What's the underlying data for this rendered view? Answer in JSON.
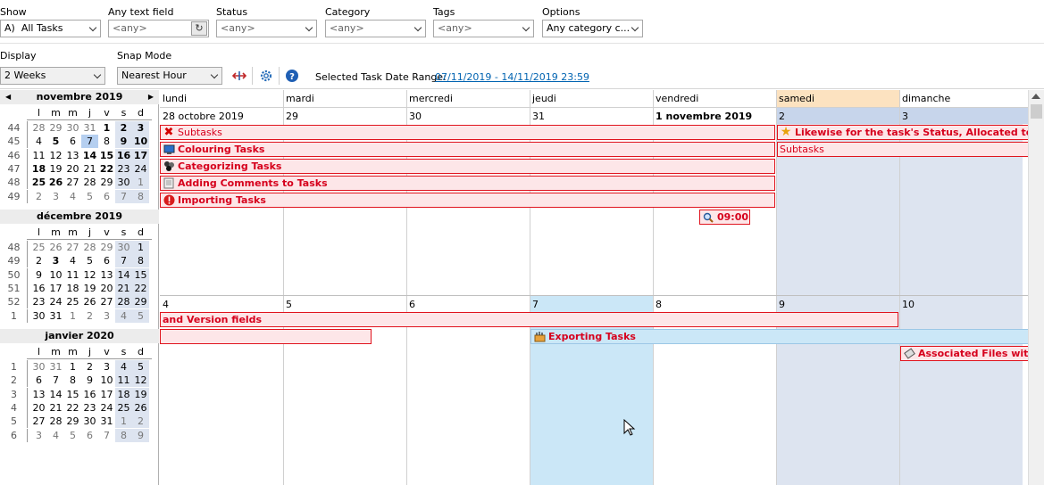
{
  "filters": {
    "show": {
      "label": "Show",
      "prefix": "A)",
      "value": "All Tasks"
    },
    "text": {
      "label": "Any text field",
      "placeholder": "<any>"
    },
    "status": {
      "label": "Status",
      "value": "<any>"
    },
    "category": {
      "label": "Category",
      "value": "<any>"
    },
    "tags": {
      "label": "Tags",
      "value": "<any>"
    },
    "options": {
      "label": "Options",
      "value": "Any category c..."
    }
  },
  "display": {
    "label": "Display",
    "value": "2 Weeks"
  },
  "snap": {
    "label": "Snap Mode",
    "value": "Nearest Hour"
  },
  "range": {
    "label": "Selected Task Date Range:",
    "value": "07/11/2019 - 14/11/2019 23:59"
  },
  "colors": {
    "task_border": "#e0141e",
    "task_fill": "#fde6e8",
    "weekend": "#dde4f0",
    "selected": "#cbe7f7",
    "saturday_header": "#fce2c0"
  },
  "months": [
    {
      "title": "novembre 2019",
      "days": [
        "l",
        "m",
        "m",
        "j",
        "v",
        "s",
        "d"
      ],
      "weeks": [
        {
          "wk": "44",
          "d": [
            "28",
            "29",
            "30",
            "31",
            "1",
            "2",
            "3"
          ]
        },
        {
          "wk": "45",
          "d": [
            "4",
            "5",
            "6",
            "7",
            "8",
            "9",
            "10"
          ]
        },
        {
          "wk": "46",
          "d": [
            "11",
            "12",
            "13",
            "14",
            "15",
            "16",
            "17"
          ]
        },
        {
          "wk": "47",
          "d": [
            "18",
            "19",
            "20",
            "21",
            "22",
            "23",
            "24"
          ]
        },
        {
          "wk": "48",
          "d": [
            "25",
            "26",
            "27",
            "28",
            "29",
            "30",
            "1"
          ]
        },
        {
          "wk": "49",
          "d": [
            "2",
            "3",
            "4",
            "5",
            "6",
            "7",
            "8"
          ]
        }
      ]
    },
    {
      "title": "décembre 2019",
      "days": [
        "l",
        "m",
        "m",
        "j",
        "v",
        "s",
        "d"
      ],
      "weeks": [
        {
          "wk": "48",
          "d": [
            "25",
            "26",
            "27",
            "28",
            "29",
            "30",
            "1"
          ]
        },
        {
          "wk": "49",
          "d": [
            "2",
            "3",
            "4",
            "5",
            "6",
            "7",
            "8"
          ]
        },
        {
          "wk": "50",
          "d": [
            "9",
            "10",
            "11",
            "12",
            "13",
            "14",
            "15"
          ]
        },
        {
          "wk": "51",
          "d": [
            "16",
            "17",
            "18",
            "19",
            "20",
            "21",
            "22"
          ]
        },
        {
          "wk": "52",
          "d": [
            "23",
            "24",
            "25",
            "26",
            "27",
            "28",
            "29"
          ]
        },
        {
          "wk": "1",
          "d": [
            "30",
            "31",
            "1",
            "2",
            "3",
            "4",
            "5"
          ]
        }
      ]
    },
    {
      "title": "janvier 2020",
      "days": [
        "l",
        "m",
        "m",
        "j",
        "v",
        "s",
        "d"
      ],
      "weeks": [
        {
          "wk": "1",
          "d": [
            "30",
            "31",
            "1",
            "2",
            "3",
            "4",
            "5"
          ]
        },
        {
          "wk": "2",
          "d": [
            "6",
            "7",
            "8",
            "9",
            "10",
            "11",
            "12"
          ]
        },
        {
          "wk": "3",
          "d": [
            "13",
            "14",
            "15",
            "16",
            "17",
            "18",
            "19"
          ]
        },
        {
          "wk": "4",
          "d": [
            "20",
            "21",
            "22",
            "23",
            "24",
            "25",
            "26"
          ]
        },
        {
          "wk": "5",
          "d": [
            "27",
            "28",
            "29",
            "30",
            "31",
            "1",
            "2"
          ]
        },
        {
          "wk": "6",
          "d": [
            "3",
            "4",
            "5",
            "6",
            "7",
            "8",
            "9"
          ]
        }
      ]
    }
  ],
  "week_days": [
    "lundi",
    "mardi",
    "mercredi",
    "jeudi",
    "vendredi",
    "samedi",
    "dimanche"
  ],
  "week1_dates": [
    "28 octobre 2019",
    "29",
    "30",
    "31",
    "1 novembre 2019",
    "2",
    "3"
  ],
  "week2_dates": [
    "4",
    "5",
    "6",
    "7",
    "8",
    "9",
    "10"
  ],
  "tasks": {
    "t1": "Subtasks",
    "t2": "Colouring Tasks",
    "t3": "Categorizing Tasks",
    "t4": "Adding Comments to Tasks",
    "t5": "Importing Tasks",
    "t6": "Likewise for the task's Status, Allocated to/by",
    "t7": "Subtasks",
    "t8": "09:00 -",
    "t9": "and Version fields",
    "t10": "Exporting Tasks",
    "t11": "Associated Files with T"
  }
}
